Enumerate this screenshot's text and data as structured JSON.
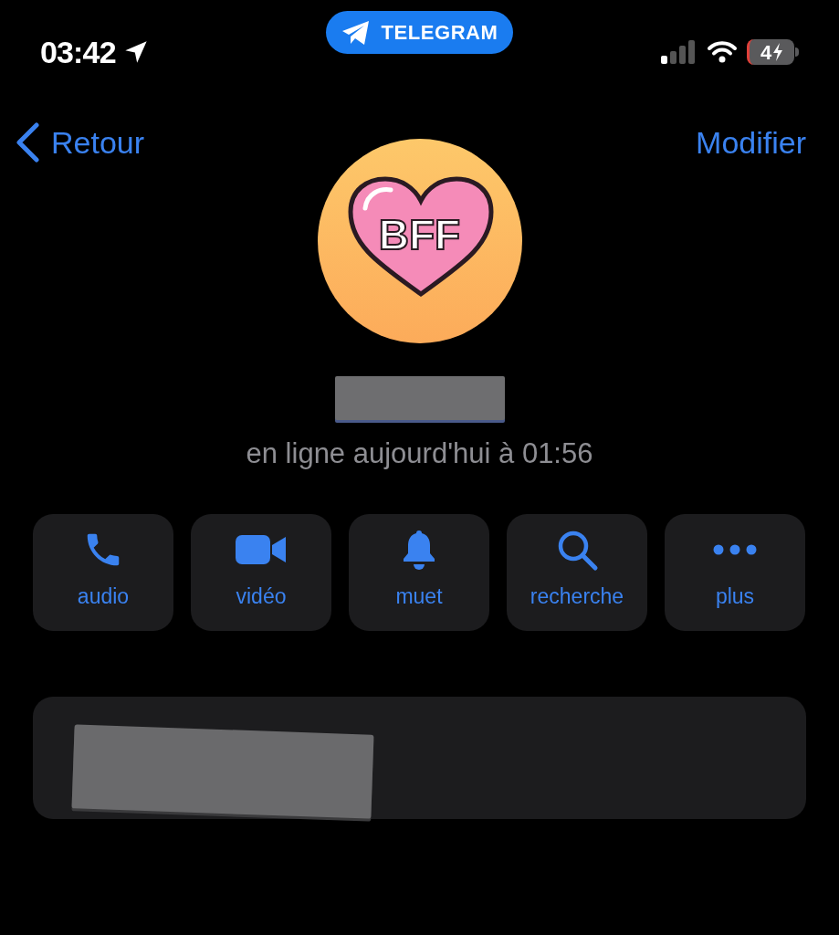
{
  "status_bar": {
    "time": "03:42",
    "app_pill": "TELEGRAM",
    "battery": "4"
  },
  "nav": {
    "back": "Retour",
    "edit": "Modifier"
  },
  "profile": {
    "avatar_text": "BFF",
    "last_seen": "en ligne aujourd'hui à 01:56"
  },
  "actions": [
    {
      "kind": "phone",
      "label": "audio"
    },
    {
      "kind": "video",
      "label": "vidéo"
    },
    {
      "kind": "bell",
      "label": "muet"
    },
    {
      "kind": "search",
      "label": "recherche"
    },
    {
      "kind": "more",
      "label": "plus"
    }
  ]
}
